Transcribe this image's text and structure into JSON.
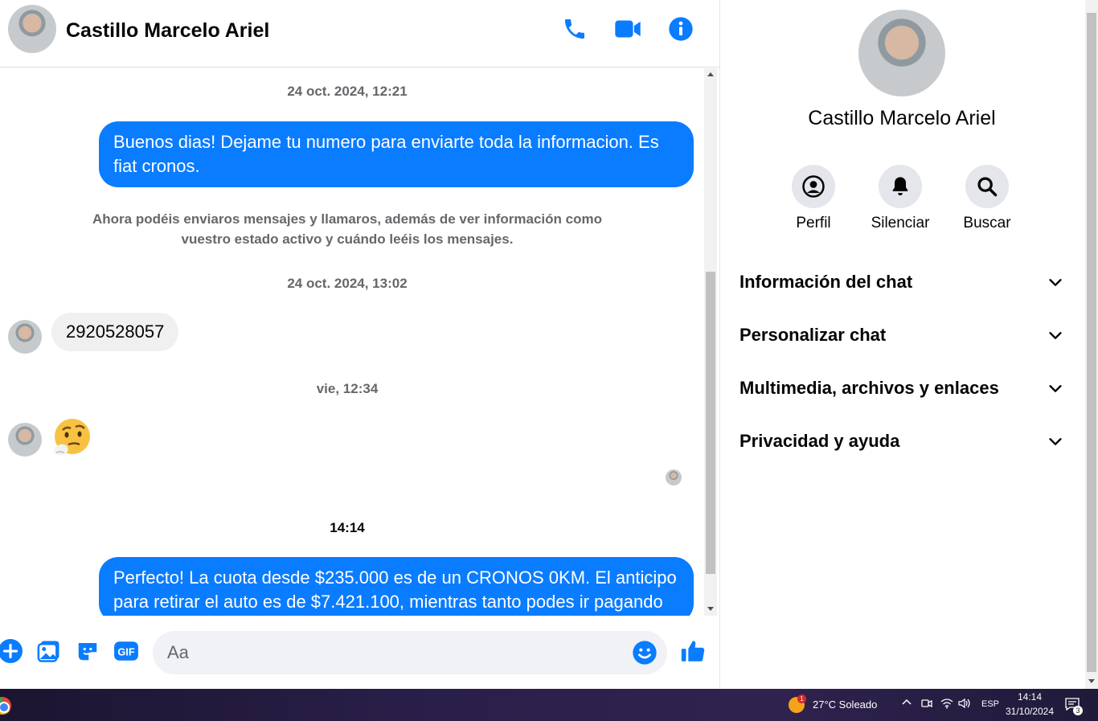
{
  "header": {
    "name": "Castillo Marcelo Ariel"
  },
  "messages": {
    "ts1": "24 oct. 2024, 12:21",
    "out1": "Buenos dias! Dejame tu numero para enviarte toda la informacion. Es fiat cronos.",
    "system_note": "Ahora podéis enviaros mensajes y llamaros, además de ver información como vuestro estado activo y cuándo leéis los mensajes.",
    "ts2": "24 oct. 2024, 13:02",
    "in1": "2920528057",
    "ts3": "vie, 12:34",
    "in2_emoji": "🤔",
    "ts4": "14:14",
    "out2": "Perfecto! La cuota desde $235.000 es de un CRONOS 0KM. El anticipo para retirar el auto es de $7.421.100, mientras tanto podes ir pagando"
  },
  "composer": {
    "placeholder": "Aa"
  },
  "info_panel": {
    "name": "Castillo Marcelo Ariel",
    "actions": [
      {
        "label": "Perfil"
      },
      {
        "label": "Silenciar"
      },
      {
        "label": "Buscar"
      }
    ],
    "sections": [
      {
        "label": "Información del chat"
      },
      {
        "label": "Personalizar chat"
      },
      {
        "label": "Multimedia, archivos y enlaces"
      },
      {
        "label": "Privacidad y ayuda"
      }
    ]
  },
  "taskbar": {
    "weather": "27°C  Soleado",
    "weather_badge": "1",
    "language": "ESP",
    "time": "14:14",
    "date": "31/10/2024",
    "notifications": "3"
  },
  "colors": {
    "accent": "#0a7cff",
    "incoming_bubble": "#f0f0f0",
    "muted_text": "#65676b"
  }
}
